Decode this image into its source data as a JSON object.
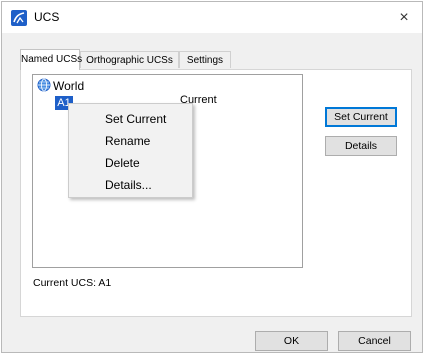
{
  "window": {
    "title": "UCS",
    "close_glyph": "×"
  },
  "tabs": [
    {
      "label": "Named UCSs",
      "active": true
    },
    {
      "label": "Orthographic UCSs",
      "active": false
    },
    {
      "label": "Settings",
      "active": false
    }
  ],
  "tree": {
    "root_label": "World",
    "root_icon": "globe-icon",
    "child_label": "A1",
    "child_status": "Current"
  },
  "context_menu": {
    "items": [
      "Set Current",
      "Rename",
      "Delete",
      "Details..."
    ]
  },
  "side_buttons": {
    "set_current": "Set Current",
    "details": "Details"
  },
  "status": {
    "current_ucs": "Current UCS:  A1"
  },
  "footer": {
    "ok": "OK",
    "cancel": "Cancel"
  },
  "colors": {
    "accent": "#1e5fc8",
    "focus_border": "#0078d7"
  }
}
